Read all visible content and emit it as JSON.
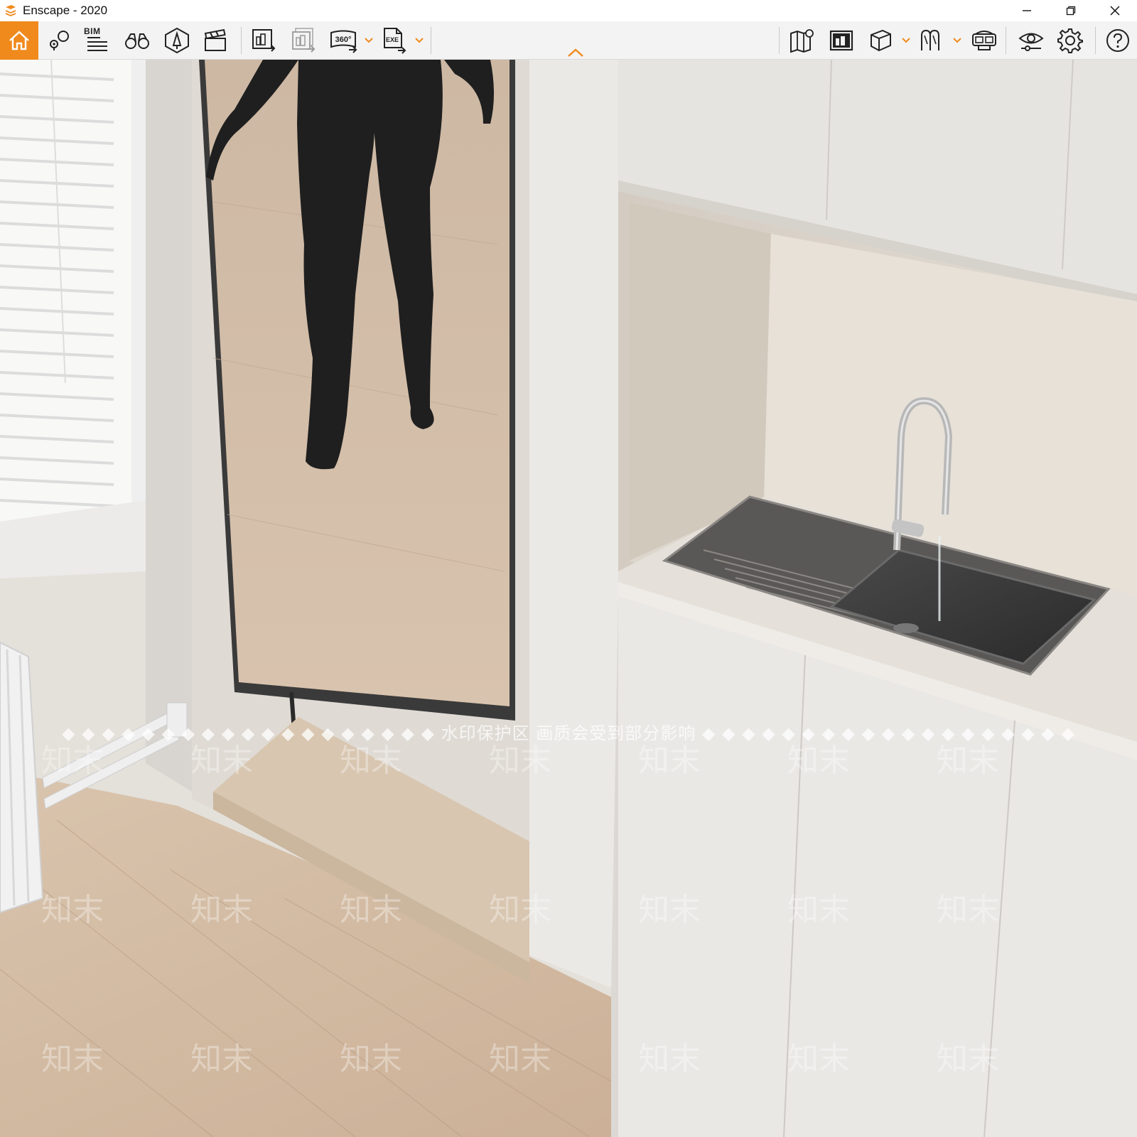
{
  "window": {
    "title": "Enscape - 2020",
    "accent": "#f08a1c"
  },
  "toolbar": {
    "bim_label": "BIM",
    "icons": [
      "home-icon",
      "view-management-icon",
      "bim-icon",
      "binoculars-icon",
      "asset-library-icon",
      "video-editor-icon",
      "screenshot-icon",
      "batch-render-icon",
      "panorama-icon",
      "exe-export-icon",
      "map-view-icon",
      "render-batch-icon",
      "cube-view-icon",
      "light-view-icon",
      "vr-headset-icon",
      "visual-settings-icon",
      "settings-icon",
      "help-icon"
    ],
    "panorama_label": "360°",
    "exe_label": "EXE"
  },
  "watermark": {
    "banner": "◆ ◆ ◆ ◆ ◆ ◆ ◆ ◆ ◆ ◆ ◆ ◆ ◆ ◆ ◆ ◆ ◆ ◆ ◆ 水印保护区  画质会受到部分影响 ◆ ◆ ◆ ◆ ◆ ◆ ◆ ◆ ◆ ◆ ◆ ◆ ◆ ◆ ◆ ◆ ◆ ◆ ◆",
    "mark": "知末"
  }
}
